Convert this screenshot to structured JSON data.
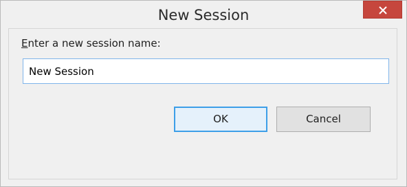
{
  "dialog": {
    "title": "New Session",
    "prompt_accel": "E",
    "prompt_rest": "nter a new session name:",
    "input_value": "New Session",
    "ok_label": "OK",
    "cancel_label": "Cancel"
  },
  "colors": {
    "close_button": "#c6463d",
    "focus_border": "#3c9ee8",
    "input_border": "#7eb4ea"
  },
  "icons": {
    "close": "close-icon"
  }
}
